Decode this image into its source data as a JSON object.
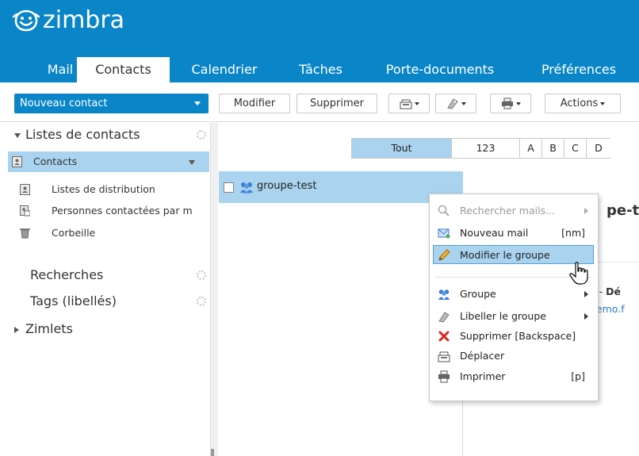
{
  "app": {
    "logo_text": "zimbra",
    "logo_icon": "zimbra-smile-icon",
    "brand_color": "#0a86c8",
    "selection_color": "#a9d3ee"
  },
  "tabs": [
    {
      "label": "Mail",
      "active": false
    },
    {
      "label": "Contacts",
      "active": true
    },
    {
      "label": "Calendrier",
      "active": false
    },
    {
      "label": "Tâches",
      "active": false
    },
    {
      "label": "Porte-documents",
      "active": false
    },
    {
      "label": "Préférences",
      "active": false
    }
  ],
  "toolbar": {
    "new_contact": "Nouveau contact",
    "edit": "Modifier",
    "delete": "Supprimer",
    "actions": "Actions"
  },
  "sidebar": {
    "contact_lists_header": "Listes de contacts",
    "items": [
      {
        "label": "Contacts",
        "icon": "address-book-icon",
        "selected": true
      },
      {
        "label": "Listes de distribution",
        "icon": "address-book-icon",
        "selected": false
      },
      {
        "label": "Personnes contactées par m",
        "icon": "address-book-emailed-icon",
        "selected": false
      },
      {
        "label": "Corbeille",
        "icon": "trash-icon",
        "selected": false
      }
    ],
    "searches_header": "Recherches",
    "tags_header": "Tags (libellés)",
    "zimlets_header": "Zimlets"
  },
  "alphabet": [
    "Tout",
    "123",
    "A",
    "B",
    "C",
    "D"
  ],
  "contacts_list": [
    {
      "name": "groupe-test",
      "icon": "group-icon",
      "selected": true
    }
  ],
  "detail": {
    "title_fragment": "pe-t",
    "sub1_prefix": "a - ",
    "sub1_bold": "Dé",
    "sub2": "demo.f"
  },
  "context_menu": {
    "items": [
      {
        "label": "Rechercher mails...",
        "icon": "search-icon",
        "shortcut": "",
        "submenu": true,
        "disabled": true,
        "hover": false
      },
      {
        "label": "Nouveau mail",
        "icon": "new-mail-icon",
        "shortcut": "[nm]",
        "submenu": false,
        "disabled": false,
        "hover": false
      },
      {
        "label": "Modifier le groupe",
        "icon": "pencil-icon",
        "shortcut": "",
        "submenu": false,
        "disabled": false,
        "hover": true
      },
      {
        "label": "Groupe",
        "icon": "group-icon",
        "shortcut": "",
        "submenu": true,
        "disabled": false,
        "hover": false
      },
      {
        "label": "Libeller le groupe",
        "icon": "tag-icon",
        "shortcut": "",
        "submenu": true,
        "disabled": false,
        "hover": false
      },
      {
        "label": "Supprimer [Backspace]",
        "icon": "delete-x-icon",
        "shortcut": "",
        "submenu": false,
        "disabled": false,
        "hover": false
      },
      {
        "label": "Déplacer",
        "icon": "move-icon",
        "shortcut": "",
        "submenu": false,
        "disabled": false,
        "hover": false
      },
      {
        "label": "Imprimer",
        "icon": "printer-icon",
        "shortcut": "[p]",
        "submenu": false,
        "disabled": false,
        "hover": false
      }
    ]
  }
}
